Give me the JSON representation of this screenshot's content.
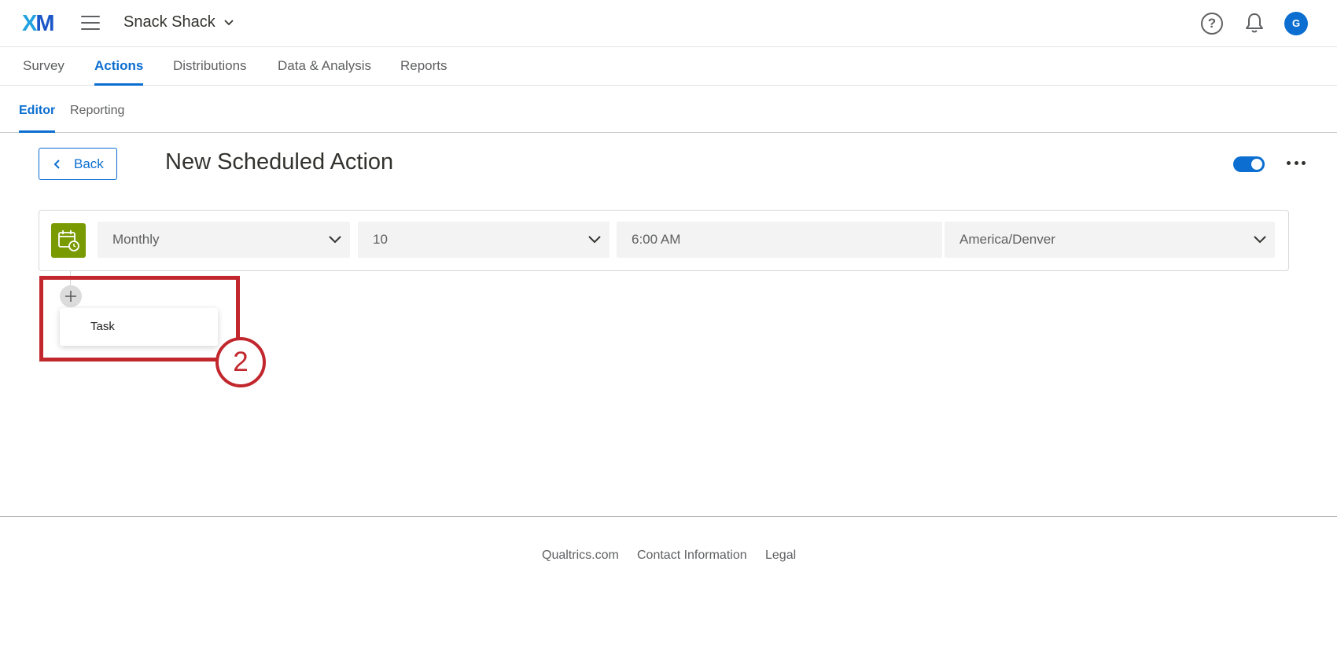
{
  "app": {
    "logo_text": "XM",
    "project_name": "Snack Shack"
  },
  "main_tabs": [
    {
      "label": "Survey",
      "active": false
    },
    {
      "label": "Actions",
      "active": true
    },
    {
      "label": "Distributions",
      "active": false
    },
    {
      "label": "Data & Analysis",
      "active": false
    },
    {
      "label": "Reports",
      "active": false
    }
  ],
  "sub_tabs": [
    {
      "label": "Editor",
      "active": true
    },
    {
      "label": "Reporting",
      "active": false
    }
  ],
  "header": {
    "back_label": "Back",
    "title": "New Scheduled Action",
    "toggle_on": true
  },
  "user": {
    "avatar_initial": "G"
  },
  "trigger": {
    "frequency": "Monthly",
    "day": "10",
    "time": "6:00 AM",
    "timezone": "America/Denver"
  },
  "add_menu": {
    "items": [
      "Task"
    ]
  },
  "annotation": {
    "step_number": "2"
  },
  "footer": {
    "links": [
      "Qualtrics.com",
      "Contact Information",
      "Legal"
    ]
  },
  "colors": {
    "accent": "#0b6ed0",
    "trigger_icon_bg": "#7a9a01",
    "annotation": "#c1272d"
  }
}
